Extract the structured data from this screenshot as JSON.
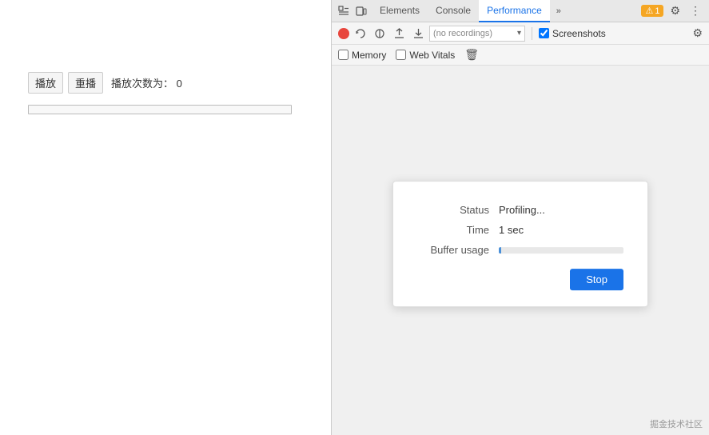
{
  "leftPanel": {
    "playButton": "播放",
    "replayButton": "重播",
    "playCountLabel": "播放次数为：",
    "playCount": "0"
  },
  "devtools": {
    "topbar": {
      "icons": [
        "inspect-icon",
        "device-icon"
      ],
      "tabs": [
        {
          "label": "Elements",
          "active": false
        },
        {
          "label": "Console",
          "active": false
        },
        {
          "label": "Performance",
          "active": true
        }
      ],
      "moreIcon": "»",
      "warningCount": "1",
      "gearIcon": "⚙",
      "moreOptionsIcon": "⋮"
    },
    "toolbar": {
      "recordingsPlaceholder": "(no recordings)",
      "screenshotsLabel": "Screenshots"
    },
    "toolbar2": {
      "memoryLabel": "Memory",
      "webVitalsLabel": "Web Vitals"
    },
    "dialog": {
      "statusLabel": "Status",
      "statusValue": "Profiling...",
      "timeLabel": "Time",
      "timeValue": "1 sec",
      "bufferLabel": "Buffer usage",
      "stopButton": "Stop"
    }
  },
  "watermark": "掘金技术社区"
}
